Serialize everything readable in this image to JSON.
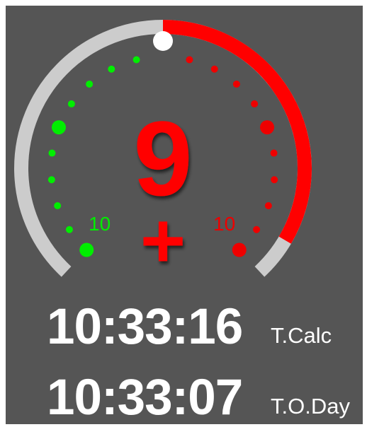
{
  "gauge": {
    "current_value": "9",
    "sign_symbol": "+",
    "left_scale_label": "10",
    "right_scale_label": "10",
    "fill_fraction": 0.44,
    "colors": {
      "background": "#555555",
      "track": "#cccccc",
      "fill": "#ff0000",
      "left_dots": "#00ee00",
      "right_dots": "#ee0000",
      "top_marker": "#ffffff"
    }
  },
  "times": {
    "calc": {
      "value": "10:33:16",
      "label": "T.Calc"
    },
    "oday": {
      "value": "10:33:07",
      "label": "T.O.Day"
    }
  }
}
